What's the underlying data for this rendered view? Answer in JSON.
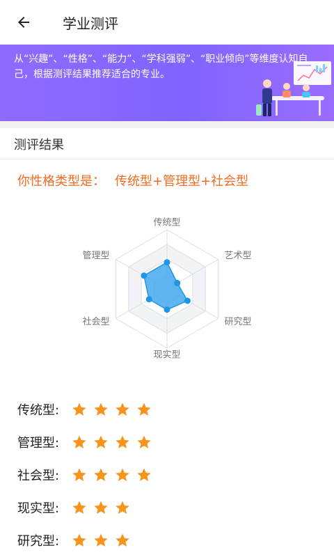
{
  "appbar": {
    "title": "学业测评",
    "back_icon": "arrow-left-icon"
  },
  "banner": {
    "text": "从“兴趣”、“性格”、“能力”、“学科强弱”、“职业倾向”等维度认知自己，根据测评结果推荐适合的专业。",
    "illustration": "office-meeting-illustration"
  },
  "section": {
    "title": "测评结果"
  },
  "result": {
    "prefix": "你性格类型是：",
    "types": "传统型+管理型+社会型"
  },
  "radar": {
    "axes": [
      "传统型",
      "艺术型",
      "研究型",
      "现实型",
      "社会型",
      "管理型"
    ],
    "values": [
      0.45,
      0.2,
      0.4,
      0.35,
      0.35,
      0.45
    ],
    "max": 1,
    "colors": {
      "fill": "#43a9ef",
      "stroke": "#1e95e6",
      "grid": "#dddddd",
      "band": "#f1f3f6"
    }
  },
  "ratings": [
    {
      "label": "传统型:",
      "stars": 4
    },
    {
      "label": "管理型:",
      "stars": 4
    },
    {
      "label": "社会型:",
      "stars": 4
    },
    {
      "label": "现实型:",
      "stars": 3
    },
    {
      "label": "研究型:",
      "stars": 3
    }
  ],
  "colors": {
    "accent": "#f26b21",
    "star": "#f7941d",
    "banner_start": "#8f6bff"
  }
}
